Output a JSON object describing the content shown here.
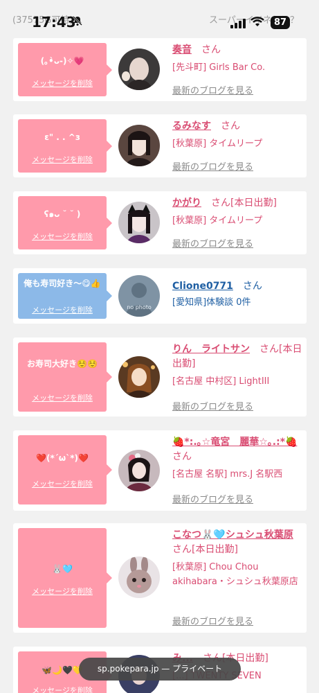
{
  "status_bar": {
    "behind_left": "(37575G可持)",
    "behind_right": "スーパーイイネとは？",
    "time": "17:43",
    "battery": "87"
  },
  "entries": [
    {
      "message": "(｡•̀ᴗ-)✧💗",
      "delete_label": "メッセージを削除",
      "name": "奏音",
      "suffix": "さん",
      "shop": "[先斗町] Girls Bar Co.",
      "blog_label": "最新のブログを見る"
    },
    {
      "message": "ε\" . . ^з",
      "delete_label": "メッセージを削除",
      "name": "るみなす",
      "suffix": "さん",
      "shop": "[秋葉原] タイムリープ",
      "blog_label": "最新のブログを見る"
    },
    {
      "message": "ʕ๑ᴗ ˘ ˘ )",
      "delete_label": "メッセージを削除",
      "name": "かがり",
      "suffix": "さん[本日出勤]",
      "shop": "[秋葉原] タイムリープ",
      "blog_label": "最新のブログを見る"
    },
    {
      "message": "俺も寿司好き〜😋👍",
      "delete_label": "メッセージを削除",
      "name": "Clione0771",
      "suffix": "さん",
      "shop": "[愛知県]体験談 0件",
      "avatar_text": "no photo"
    },
    {
      "message": "お寿司大好き☺️☺️",
      "delete_label": "メッセージを削除",
      "name": "りん　ライトサン",
      "suffix": "さん[本日出勤]",
      "shop": "[名古屋 中村区] LightIII",
      "blog_label": "最新のブログを見る"
    },
    {
      "message": "❤️(*´ω`*)❤️",
      "delete_label": "メッセージを削除",
      "name": "🍓*:.｡☆竜宮　麗華☆｡.:*🍓",
      "suffix": "さん",
      "shop": "[名古屋 名駅] mrs.J 名駅西",
      "blog_label": "最新のブログを見る"
    },
    {
      "message": "🐰🩵",
      "delete_label": "メッセージを削除",
      "name": "こなつ🐰🩵シュシュ秋葉原",
      "suffix": "さん[本日出勤]",
      "shop": "[秋葉原] Chou Chou akihabara・シュシュ秋葉原店",
      "blog_label": "最新のブログを見る"
    },
    {
      "message": "🦋🌙🖤💛",
      "delete_label": "メッセージを削除",
      "name": "み...",
      "suffix": "さん[本日出勤]",
      "shop": "[...] TWENTY SEVEN"
    }
  ],
  "url_bar": {
    "text": "sp.pokepara.jp — プライベート"
  },
  "colors": {
    "accent": "#d94c72",
    "bubble_pink": "#ff9aab",
    "bubble_blue": "#8cb9e8",
    "link_blue": "#1f5fa3"
  }
}
